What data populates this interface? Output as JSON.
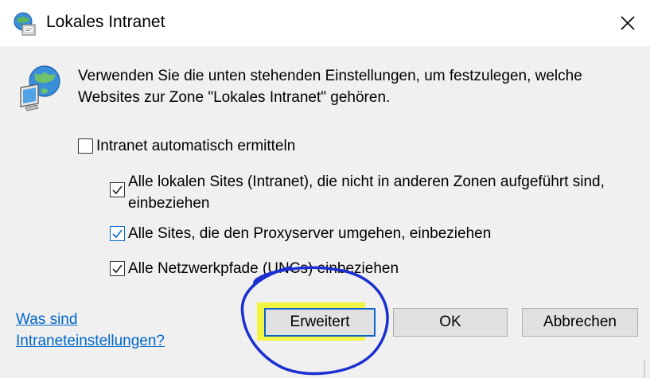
{
  "window": {
    "title": "Lokales Intranet",
    "icon": "globe-computer-icon",
    "close_glyph": "✕"
  },
  "main": {
    "icon": "globe-monitor-icon",
    "description": "Verwenden Sie die unten stehenden Einstellungen, um festzulegen, welche Websites zur Zone \"Lokales Intranet\" gehören.",
    "checkboxes": [
      {
        "label": "Intranet automatisch ermitteln",
        "checked": false
      },
      {
        "label": "Alle lokalen Sites (Intranet), die nicht in anderen Zonen aufgeführt sind, einbeziehen",
        "checked": true
      },
      {
        "label": "Alle Sites, die den Proxyserver umgehen, einbeziehen",
        "checked": true
      },
      {
        "label": "Alle Netzwerkpfade (UNCs) einbeziehen",
        "checked": true
      }
    ]
  },
  "footer": {
    "help_link": "Was sind Intraneteinstellungen?",
    "buttons": {
      "advanced": "Erweitert",
      "ok": "OK",
      "cancel": "Abbrechen"
    }
  },
  "colors": {
    "dialog_bg": "#f0f0f0",
    "link": "#0066cc",
    "focus_blue": "#0a64c8",
    "highlight_yellow": "#f4f433",
    "annotation_blue": "#1a2fd0"
  }
}
